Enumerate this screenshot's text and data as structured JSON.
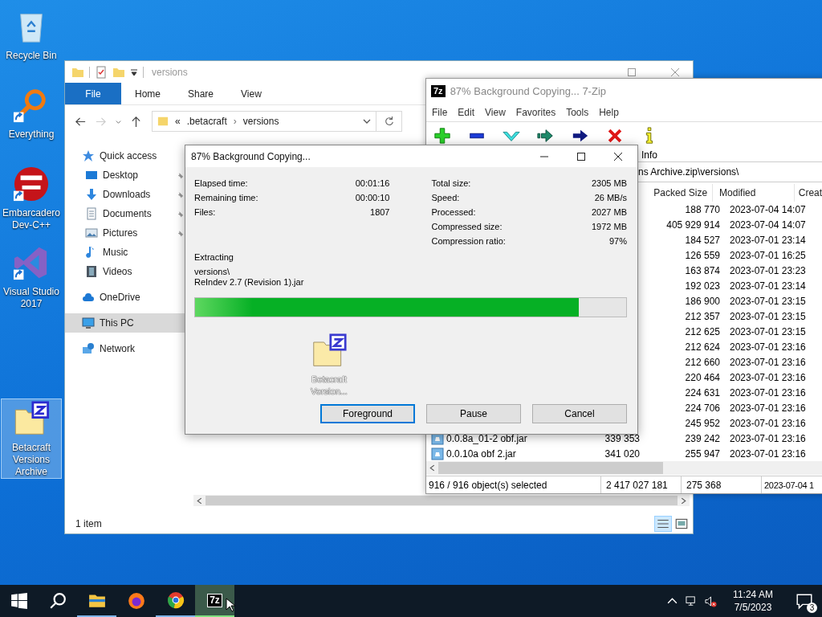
{
  "desktop_icons": [
    {
      "label": "Recycle Bin",
      "kind": "recycle",
      "shortcut": false,
      "selected": false
    },
    {
      "label": "Everything",
      "kind": "everything",
      "shortcut": true,
      "selected": false
    },
    {
      "label": "Embarcadero Dev-C++",
      "kind": "devcpp",
      "shortcut": true,
      "selected": false
    },
    {
      "label": "Visual Studio 2017",
      "kind": "vs",
      "shortcut": true,
      "selected": false
    },
    {
      "label": "Betacraft Versions Archive",
      "kind": "archive",
      "shortcut": false,
      "selected": true
    }
  ],
  "explorer": {
    "title": "versions",
    "ribbon_tabs": [
      {
        "label": "File",
        "selected": true
      },
      {
        "label": "Home",
        "selected": false
      },
      {
        "label": "Share",
        "selected": false
      },
      {
        "label": "View",
        "selected": false
      }
    ],
    "address": {
      "overflow": "«",
      "separator": "›",
      "segments": [
        ".betacraft",
        "versions"
      ]
    },
    "nav": [
      {
        "label": "Quick access",
        "kind": "star",
        "selected": false,
        "children": [
          {
            "label": "Desktop",
            "kind": "desktop",
            "pinned": true,
            "selected": false
          },
          {
            "label": "Downloads",
            "kind": "downloads",
            "pinned": true,
            "selected": false
          },
          {
            "label": "Documents",
            "kind": "documents",
            "pinned": true,
            "selected": false
          },
          {
            "label": "Pictures",
            "kind": "pictures",
            "pinned": true,
            "selected": false
          },
          {
            "label": "Music",
            "kind": "music",
            "pinned": false,
            "selected": false
          },
          {
            "label": "Videos",
            "kind": "videos",
            "pinned": false,
            "selected": false
          }
        ]
      },
      {
        "label": "OneDrive",
        "kind": "cloud",
        "selected": false
      },
      {
        "label": "This PC",
        "kind": "pc",
        "selected": true
      },
      {
        "label": "Network",
        "kind": "network",
        "selected": false
      }
    ],
    "status": "1 item"
  },
  "sevenzip": {
    "title": "87% Background Copying... 7-Zip",
    "app_icon": "7z",
    "menu": [
      "File",
      "Edit",
      "View",
      "Favorites",
      "Tools",
      "Help"
    ],
    "toolbar": [
      {
        "kind": "add"
      },
      {
        "kind": "extract"
      },
      {
        "kind": "test"
      },
      {
        "kind": "copy"
      },
      {
        "kind": "move"
      },
      {
        "kind": "delete"
      },
      {
        "kind": "info",
        "label": "Info"
      }
    ],
    "path": "ns Archive.zip\\versions\\",
    "columns": [
      "Packed Size",
      "Modified",
      "Creat"
    ],
    "rows": [
      {
        "packed": "188 770",
        "modified": "2023-07-04 14:07"
      },
      {
        "packed": "405 929 914",
        "modified": "2023-07-04 14:07"
      },
      {
        "packed": "184 527",
        "modified": "2023-07-01 23:14"
      },
      {
        "packed": "126 559",
        "modified": "2023-07-01 16:25"
      },
      {
        "packed": "163 874",
        "modified": "2023-07-01 23:23"
      },
      {
        "packed": "192 023",
        "modified": "2023-07-01 23:14"
      },
      {
        "packed": "186 900",
        "modified": "2023-07-01 23:15"
      },
      {
        "packed": "212 357",
        "modified": "2023-07-01 23:15"
      },
      {
        "packed": "212 625",
        "modified": "2023-07-01 23:15"
      },
      {
        "packed": "212 624",
        "modified": "2023-07-01 23:16"
      },
      {
        "packed": "212 660",
        "modified": "2023-07-01 23:16"
      },
      {
        "packed": "220 464",
        "modified": "2023-07-01 23:16"
      },
      {
        "packed": "224 631",
        "modified": "2023-07-01 23:16"
      },
      {
        "packed": "224 706",
        "modified": "2023-07-01 23:16"
      },
      {
        "packed": "245 952",
        "modified": "2023-07-01 23:16"
      },
      {
        "name": "0.0.8a_01-2 obf.jar",
        "size": "339 353",
        "packed": "239 242",
        "modified": "2023-07-01 23:16"
      },
      {
        "name": "0.0.10a obf 2.jar",
        "size": "341 020",
        "packed": "255 947",
        "modified": "2023-07-01 23:16"
      }
    ],
    "status": [
      "916 / 916 object(s) selected",
      "2 417 027 181",
      "275 368",
      "2023-07-04 1"
    ]
  },
  "dialog": {
    "title": "87% Background Copying...",
    "stats_left": [
      {
        "label": "Elapsed time:",
        "value": "00:01:16"
      },
      {
        "label": "Remaining time:",
        "value": "00:00:10"
      },
      {
        "label": "Files:",
        "value": "1807"
      }
    ],
    "stats_right": [
      {
        "label": "Total size:",
        "value": "2305 MB"
      },
      {
        "label": "Speed:",
        "value": "26 MB/s"
      },
      {
        "label": "Processed:",
        "value": "2027 MB"
      },
      {
        "label": "Compressed size:",
        "value": "1972 MB"
      },
      {
        "label": "Compression ratio:",
        "value": "97%"
      }
    ],
    "operation": "Extracting",
    "folder": "versions\\",
    "file": "ReIndev 2.7 (Revision 1).jar",
    "progress": {
      "level": 0.89
    },
    "drag_ghost": {
      "label": "Betacraft Version..."
    },
    "buttons": [
      {
        "label": "Foreground",
        "focused": true
      },
      {
        "label": "Pause",
        "focused": false
      },
      {
        "label": "Cancel",
        "focused": false
      }
    ]
  },
  "taskbar": {
    "apps": [
      {
        "kind": "explorer",
        "running": true,
        "focused": false
      },
      {
        "kind": "firefox",
        "running": false,
        "focused": false
      },
      {
        "kind": "chrome",
        "running": true,
        "focused": false
      },
      {
        "kind": "sevenzip",
        "label": "7z",
        "running": true,
        "focused": true
      }
    ],
    "time": "11:24 AM",
    "date": "7/5/2023",
    "notifications": "3"
  }
}
